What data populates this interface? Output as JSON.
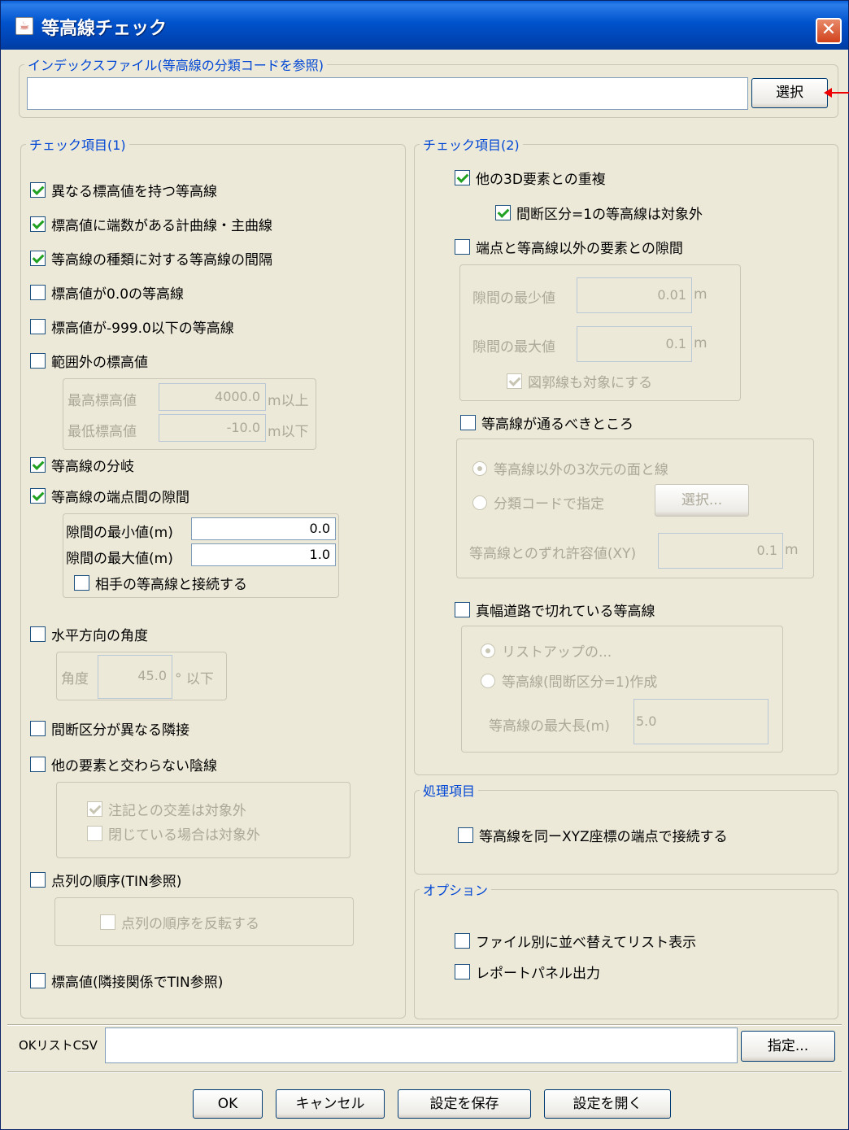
{
  "window": {
    "title": "等高線チェック",
    "close_glyph": "✕"
  },
  "index_file": {
    "legend": "インデックスファイル(等高線の分類コードを参照)",
    "value": "",
    "select_button": "選択"
  },
  "check1": {
    "legend": "チェック項目(1)",
    "items": {
      "different_elev": "異なる標高値を持つ等高線",
      "fraction": "標高値に端数がある計曲線・主曲線",
      "interval": "等高線の種類に対する等高線の間隔",
      "zero": "標高値が0.0の等高線",
      "minus999": "標高値が-999.0以下の等高線",
      "out_of_range": "範囲外の標高値",
      "branch": "等高線の分岐",
      "endpoint_gap": "等高線の端点間の隙間",
      "horizontal_angle": "水平方向の角度",
      "break_adjacent": "間断区分が異なる隣接",
      "hidden_line": "他の要素と交わらない陰線",
      "point_order": "点列の順序(TIN参照)",
      "elev_adjacency": "標高値(隣接関係でTIN参照)"
    },
    "range": {
      "max_label": "最高標高値",
      "max_value": "4000.0",
      "max_unit": "m以上",
      "min_label": "最低標高値",
      "min_value": "-10.0",
      "min_unit": "m以下"
    },
    "gap": {
      "min_label": "隙間の最小値(m)",
      "min_value": "0.0",
      "max_label": "隙間の最大値(m)",
      "max_value": "1.0",
      "connect_label": "相手の等高線と接続する"
    },
    "angle": {
      "label": "角度",
      "value": "45.0",
      "unit": "° 以下"
    },
    "hidden": {
      "annotation_excluded": "注記との交差は対象外",
      "closed_excluded": "閉じている場合は対象外"
    },
    "order": {
      "reverse_label": "点列の順序を反転する"
    }
  },
  "check2": {
    "legend": "チェック項目(2)",
    "overlap_3d": "他の3D要素との重複",
    "break1_excluded": "間断区分=1の等高線は対象外",
    "endpoint_other_gap": "端点と等高線以外の要素との隙間",
    "gap_min_label": "隙間の最少値",
    "gap_min_value": "0.01",
    "gap_unit": "m",
    "gap_max_label": "隙間の最大値",
    "gap_max_value": "0.1",
    "frame_line": "図郭線も対象にする",
    "should_pass": "等高線が通るべきところ",
    "radio_3d": "等高線以外の3次元の面と線",
    "radio_code": "分類コードで指定",
    "code_select_button": "選択...",
    "tolerance_label": "等高線とのずれ許容値(XY)",
    "tolerance_value": "0.1",
    "tolerance_unit": "m",
    "road_cut": "真幅道路で切れている等高線",
    "radio_listup": "リストアップの...",
    "radio_create": "等高線(間断区分=1)作成",
    "max_length_label": "等高線の最大長(m)",
    "max_length_value": "5.0"
  },
  "process": {
    "legend": "処理項目",
    "connect_xyz": "等高線を同ーXYZ座標の端点で接続する"
  },
  "options": {
    "legend": "オプション",
    "sort_by_file": "ファイル別に並べ替えてリスト表示",
    "report_panel": "レポートパネル出力"
  },
  "ok_list": {
    "label": "OKリストCSV",
    "value": "",
    "specify_button": "指定..."
  },
  "footer": {
    "ok": "OK",
    "cancel": "キャンセル",
    "save": "設定を保存",
    "open": "設定を開く"
  }
}
